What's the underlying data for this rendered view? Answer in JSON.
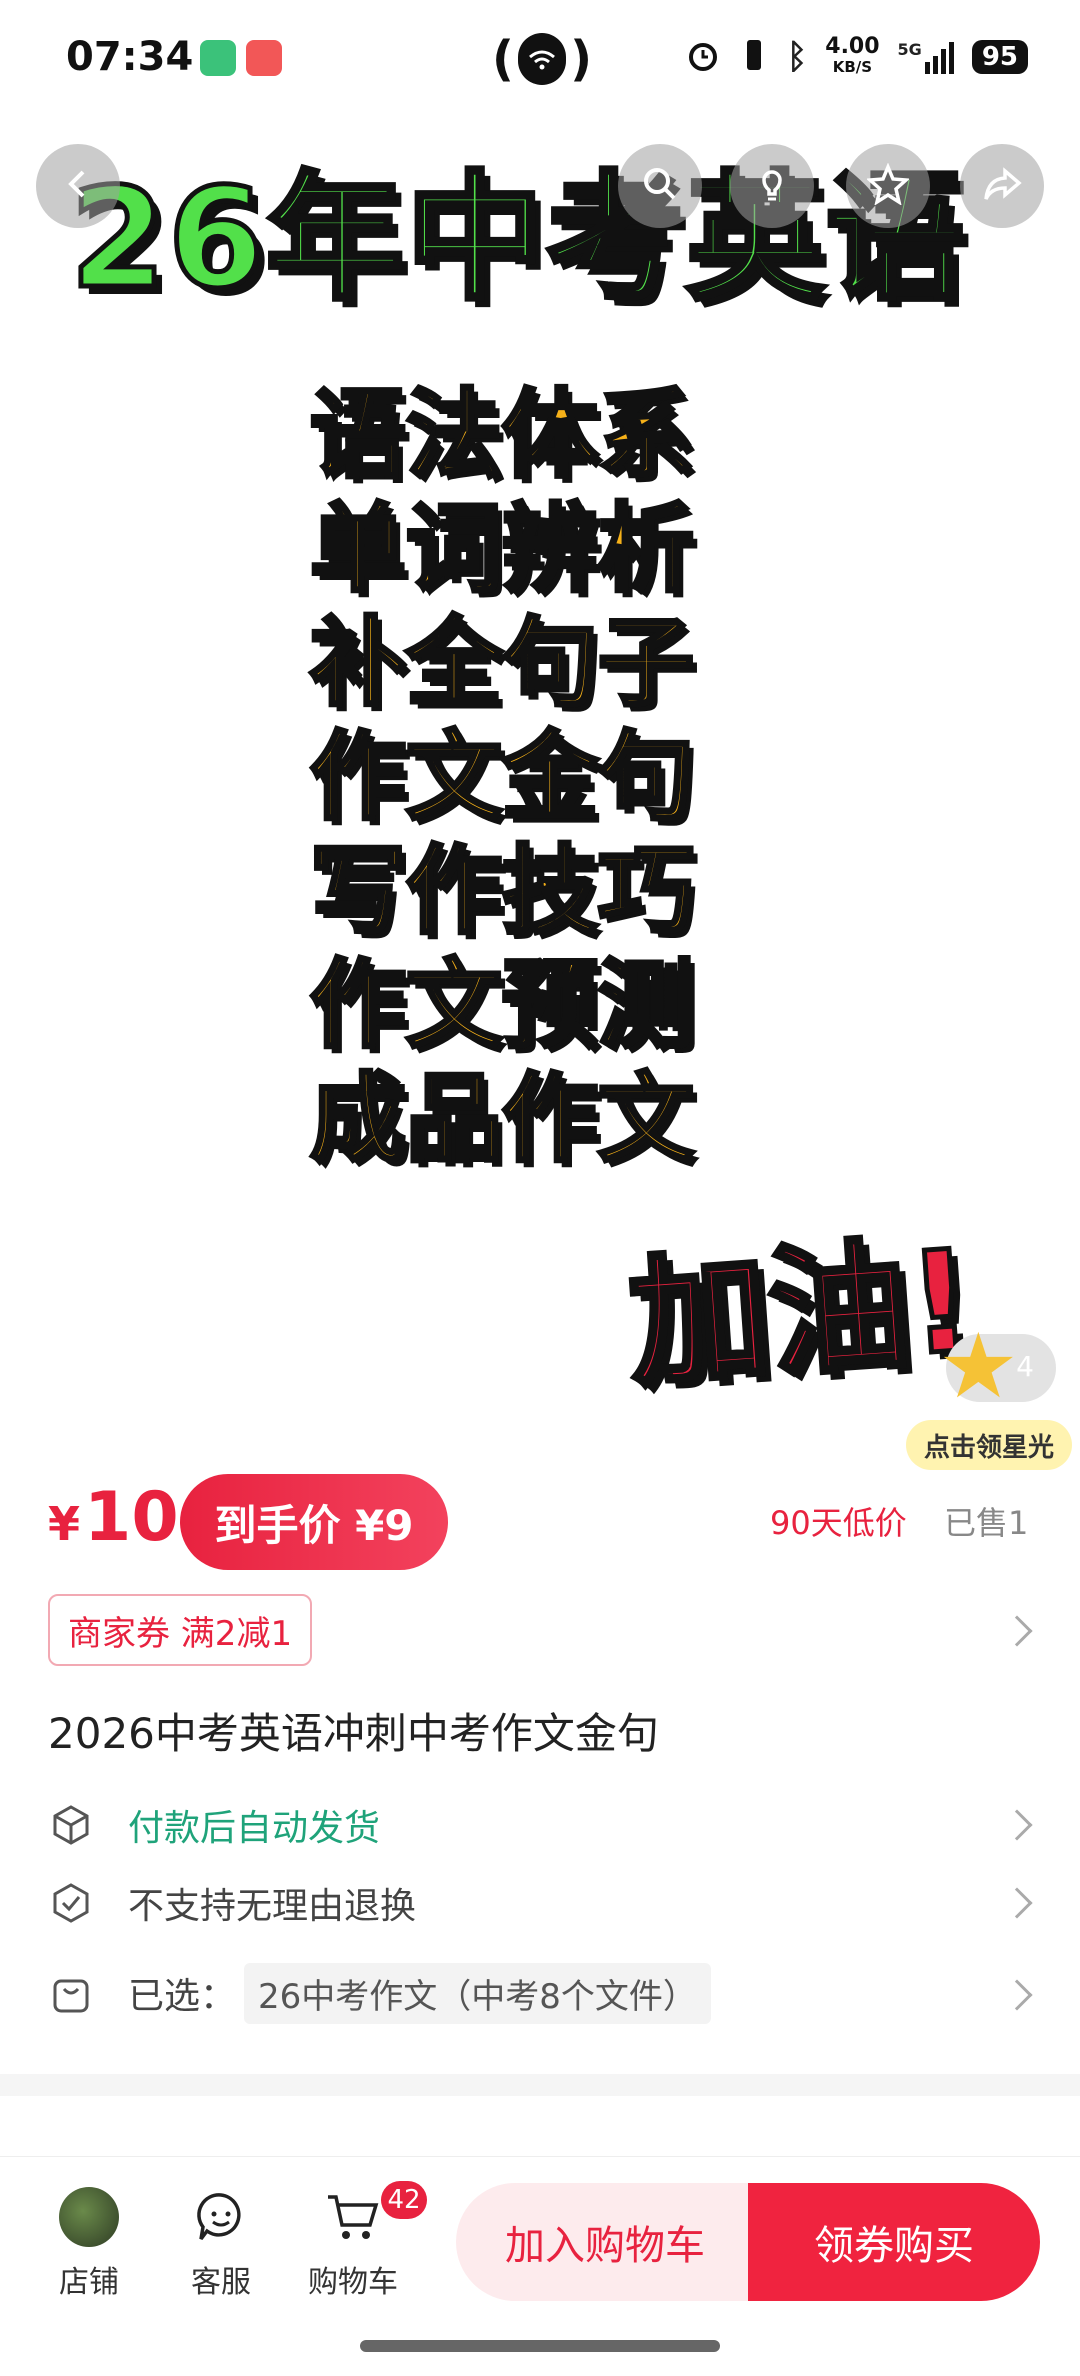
{
  "status_bar": {
    "time": "07:34",
    "net_speed": "4.00",
    "net_unit": "KB/S",
    "signal": "5G",
    "battery": "95"
  },
  "hero": {
    "headline": "26年中考英语",
    "topics": [
      "语法体系",
      "单词辨析",
      "补全句子",
      "作文金句",
      "写作技巧",
      "作文预测",
      "成品作文"
    ],
    "cheer": "加油!",
    "star_count": "4",
    "star_label": "点击领星光"
  },
  "price": {
    "currency": "¥",
    "amount": "10",
    "final_price": "到手价 ¥9",
    "low_price_tag": "90天低价",
    "sold": "已售1"
  },
  "coupon": "商家券 满2减1",
  "product_title": "2026中考英语冲刺中考作文金句",
  "info_rows": [
    {
      "text": "付款后自动发货"
    },
    {
      "text": "不支持无理由退换"
    },
    {
      "label": "已选：",
      "value": "26中考作文（中考8个文件）"
    }
  ],
  "bottom_bar": {
    "store": "店铺",
    "service": "客服",
    "cart": "购物车",
    "cart_badge": "42",
    "add_to_cart": "加入购物车",
    "buy": "领券购买"
  },
  "colors": {
    "accent": "#e8223f",
    "green_headline": "#52e04a",
    "topic_orange": "#f6b119",
    "info_green": "#1fa37a"
  }
}
